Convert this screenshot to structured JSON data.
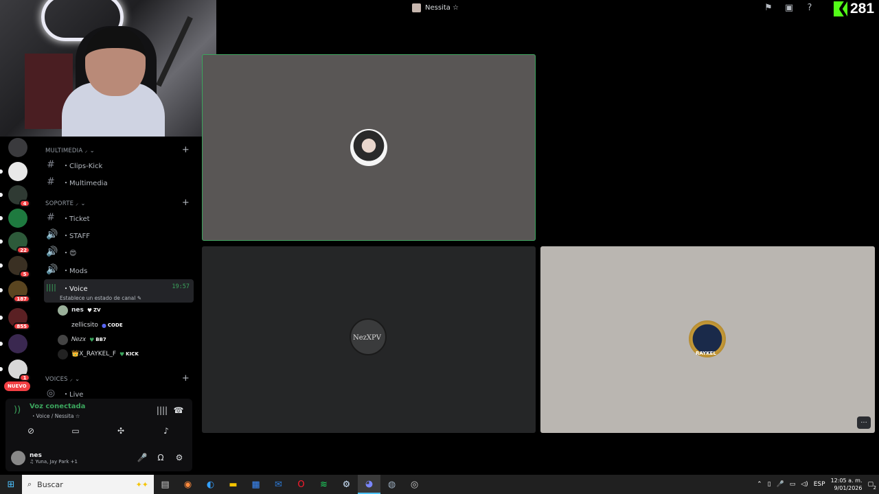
{
  "topbar": {
    "title": "Nessita ☆",
    "viewer_count": "281"
  },
  "categories": [
    {
      "label": "MULTIMEDIA ⸝ ⌄"
    },
    {
      "label": "SOPORTE ⸝ ⌄"
    },
    {
      "label": "VOICES ⸝ ⌄"
    }
  ],
  "channels": [
    {
      "label": "・Clips-Kick"
    },
    {
      "label": "・Multimedia"
    },
    {
      "label": "・Ticket"
    },
    {
      "label": "・STAFF"
    },
    {
      "label": "・😍"
    },
    {
      "label": "・Mods"
    },
    {
      "label": "・Voice",
      "time": "19:57",
      "status": "Establece un estado de canal ✎"
    },
    {
      "label": "・Live"
    }
  ],
  "voice_users": [
    {
      "name": "𝗻𝗲𝘀",
      "tag": "ZV",
      "tag_color": "#ffffff"
    },
    {
      "name": "zellicsito",
      "tag": "CODE",
      "tag_color": "#5865f2"
    },
    {
      "name": "𝑁𝑒𝑧𝑥",
      "tag": "BB7",
      "tag_color": "#3ba55d"
    },
    {
      "name": "👑X_RAYKEL_F",
      "tag": "KICK",
      "tag_color": "#3ba55d"
    }
  ],
  "server_badges": [
    "4",
    "22",
    "5",
    "187",
    "855",
    "1"
  ],
  "new_badge": "NUEVO",
  "voice_panel": {
    "status": "Voz conectada",
    "channel": "・Voice / Nessita ☆",
    "user_name": "𝗻𝗲𝘀",
    "user_status": "♫ Yuna, Jay Park +1"
  },
  "tiles": [
    {
      "avatar_label": ""
    },
    {
      "avatar_label": "NezXPV"
    },
    {
      "avatar_label": "RAYKEL"
    }
  ],
  "taskbar": {
    "search_placeholder": "Buscar",
    "language": "ESP",
    "time": "12:05 a. m.",
    "date": "9/01/2026",
    "notifications": "2"
  },
  "colors": {
    "accent_green": "#3ba55d",
    "kick_green": "#53fc18",
    "danger": "#f23f43"
  }
}
